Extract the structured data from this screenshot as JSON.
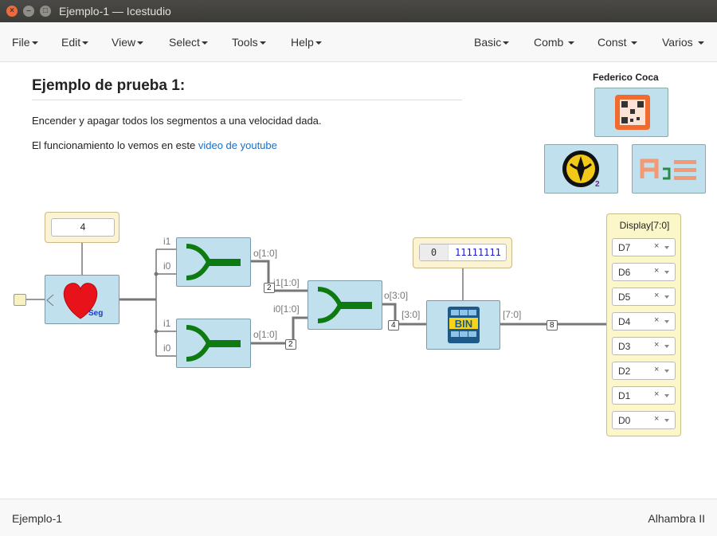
{
  "window": {
    "title": "Ejemplo-1 — Icestudio"
  },
  "menubar": {
    "left": [
      {
        "label": "File"
      },
      {
        "label": "Edit"
      },
      {
        "label": "View"
      },
      {
        "label": "Select"
      },
      {
        "label": "Tools"
      },
      {
        "label": "Help"
      }
    ],
    "right": [
      {
        "label": "Basic"
      },
      {
        "label": "Comb"
      },
      {
        "label": "Const"
      },
      {
        "label": "Varios"
      }
    ]
  },
  "info": {
    "title": "Ejemplo de prueba 1:",
    "line1": "Encender y apagar todos los segmentos a una velocidad dada.",
    "line2_prefix": "El funcionamiento lo vemos en este ",
    "line2_link": "video de youtube"
  },
  "author": {
    "name": "Federico Coca"
  },
  "circuit": {
    "const_value": "4",
    "heart_label": "Seg",
    "join1": {
      "in_hi": "i1",
      "in_lo": "i0",
      "out": "o[1:0]"
    },
    "join2": {
      "in_hi": "i1",
      "in_lo": "i0",
      "out": "o[1:0]"
    },
    "join3": {
      "in_hi": "i1[1:0]",
      "in_lo": "i0[1:0]",
      "out": "o[3:0]"
    },
    "bin": {
      "in": "[3:0]",
      "out": "[7:0]",
      "label": "BIN",
      "param_left": "0",
      "param_value": "11111111"
    },
    "badges": {
      "b1": "2",
      "b2": "2",
      "b3": "4",
      "b4": "8"
    },
    "icon_badge": "2"
  },
  "display": {
    "title": "Display[7:0]",
    "pins": [
      "D7",
      "D6",
      "D5",
      "D4",
      "D3",
      "D2",
      "D1",
      "D0"
    ],
    "clear": "×"
  },
  "footer": {
    "left": "Ejemplo-1",
    "right": "Alhambra II"
  },
  "colors": {
    "block": "#bfe0ec",
    "const": "#fcf3d2",
    "wire": "#777777",
    "bus": "#777777",
    "link": "#1a6fc4",
    "green": "#1a8a1a"
  }
}
